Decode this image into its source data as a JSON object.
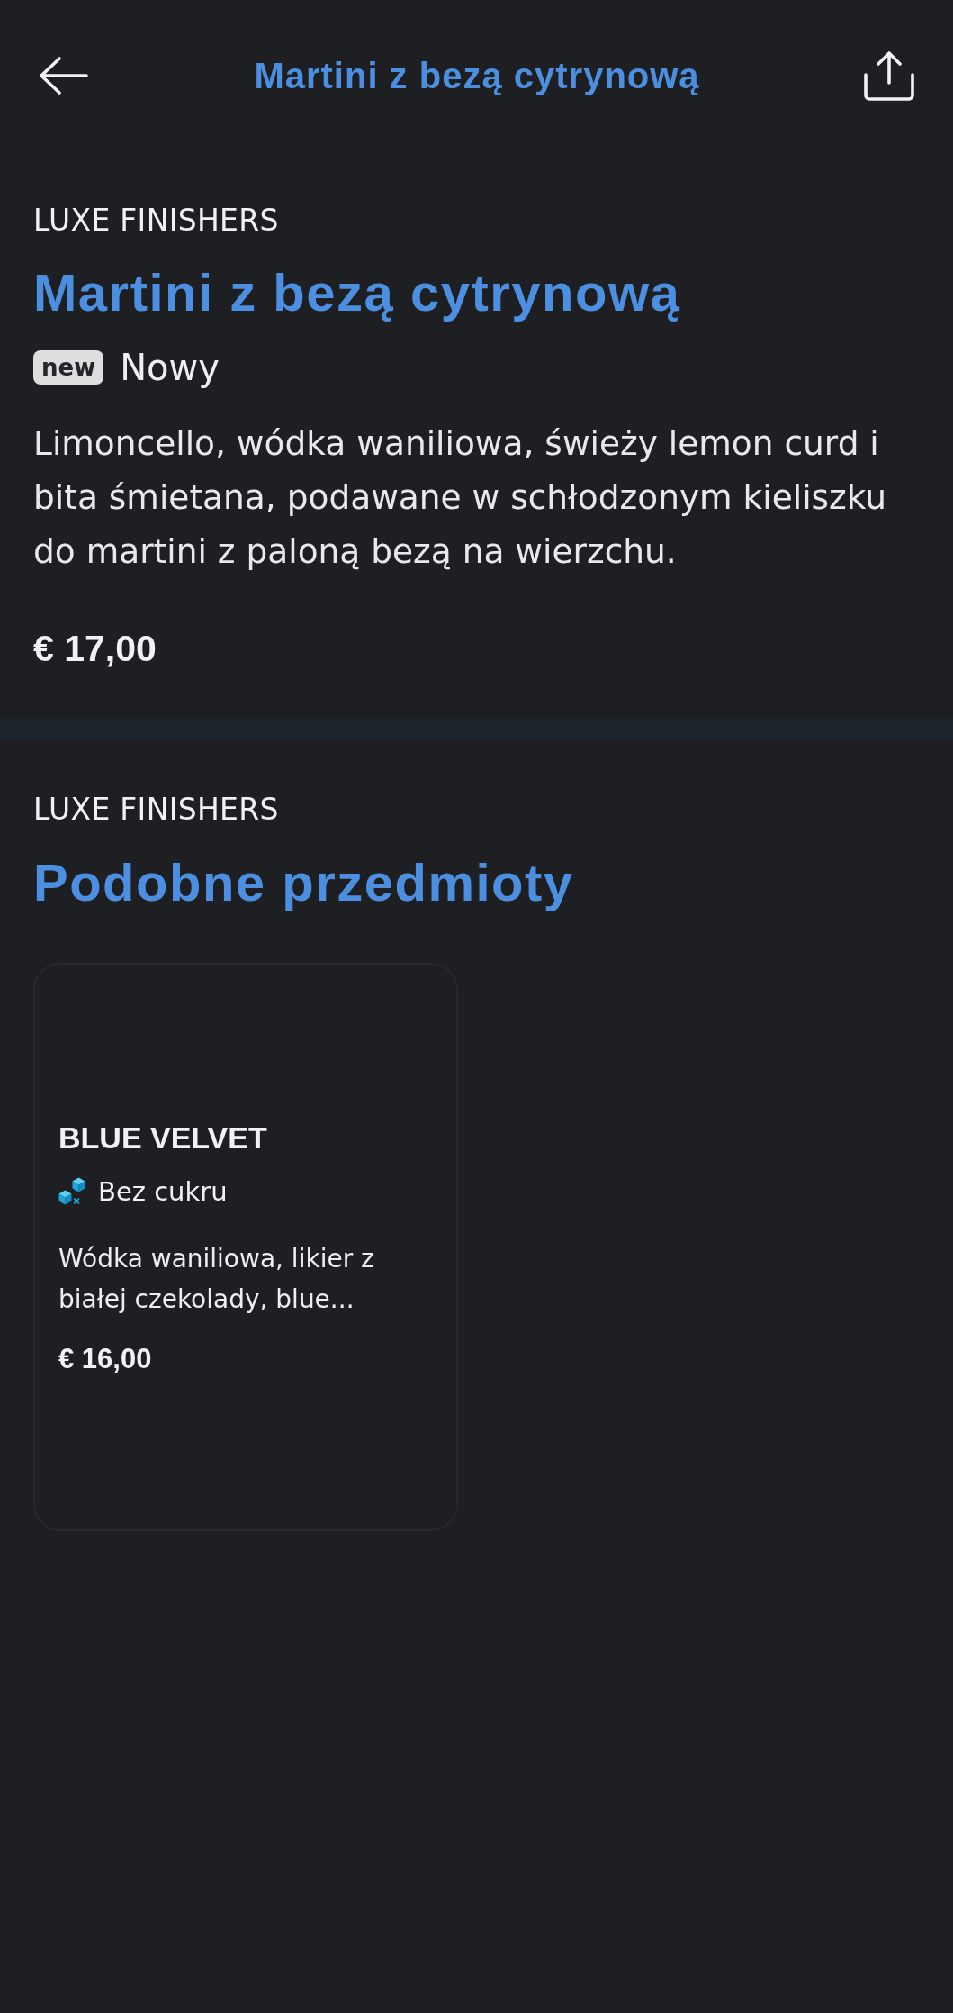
{
  "header": {
    "title": "Martini z bezą cytrynową"
  },
  "item": {
    "category": "LUXE FINISHERS",
    "name": "Martini z bezą cytrynową",
    "status": {
      "badge": "new",
      "label": "Nowy"
    },
    "description": "Limoncello, wódka waniliowa, świeży lemon curd i bita śmietana, podawane w schłodzonym kieliszku do martini z paloną bezą na wierzchu.",
    "price": "€ 17,00"
  },
  "similar": {
    "category": "LUXE FINISHERS",
    "title": "Podobne przedmioty",
    "items": [
      {
        "name": "BLUE VELVET",
        "tags": [
          {
            "kind": "sugar_free",
            "label": "Bez cukru"
          }
        ],
        "description": "Wódka waniliowa, likier z białej czekolady, blue...",
        "price": "€ 16,00"
      }
    ]
  }
}
